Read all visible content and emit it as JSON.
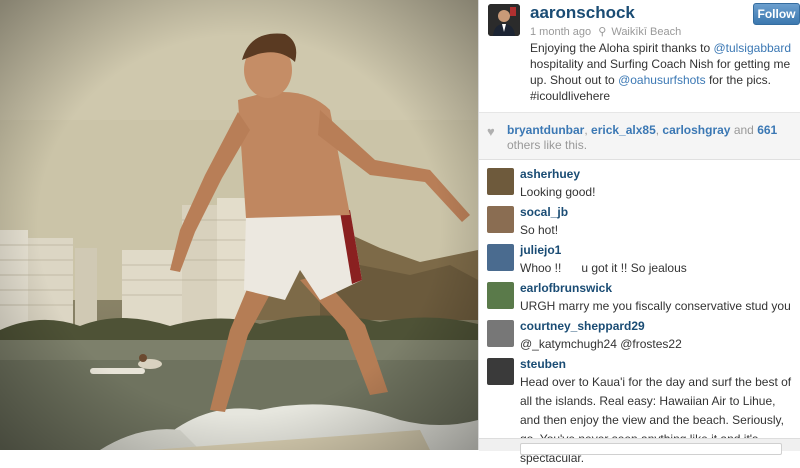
{
  "post": {
    "username": "aaronschock",
    "follow_label": "Follow",
    "time_ago": "1 month ago",
    "location": "Waikīkī Beach",
    "caption": [
      {
        "text": "Enjoying the Aloha spirit thanks to ",
        "link": false
      },
      {
        "text": "@tulsigabbard",
        "link": true
      },
      {
        "text": " hospitality and Surfing Coach Nish for getting me up. Shout out to ",
        "link": false
      },
      {
        "text": "@oahusurfshots",
        "link": true
      },
      {
        "text": " for the pics. #icouldlivehere",
        "link": false
      }
    ]
  },
  "likes": {
    "users": [
      "bryantdunbar",
      "erick_alx85",
      "carloshgray"
    ],
    "and_label": "and",
    "others_count": "661",
    "tail": "others like this."
  },
  "comments": [
    {
      "user": "asherhuey",
      "text": "Looking good!",
      "avatar_color": "#6e5a3c"
    },
    {
      "user": "socal_jb",
      "text": "So hot!",
      "avatar_color": "#8a6d52"
    },
    {
      "user": "juliejo1",
      "text": "Whoo !!      u got it !! So jealous",
      "avatar_color": "#4a6b8f"
    },
    {
      "user": "earlofbrunswick",
      "text": "URGH marry me you fiscally conservative stud you",
      "avatar_color": "#5a7a4a"
    },
    {
      "user": "courtney_sheppard29",
      "text": "@_katymchugh24 @frostes22",
      "avatar_color": "#777777"
    },
    {
      "user": "steuben",
      "text": "Head over to Kaua'i for the day and surf the best of all the islands. Real easy: Hawaiian Air to Lihue, and then enjoy the view and the beach. Seriously, go. You've never seen anything like it and it's spectacular.",
      "avatar_color": "#3a3a3a"
    }
  ]
}
